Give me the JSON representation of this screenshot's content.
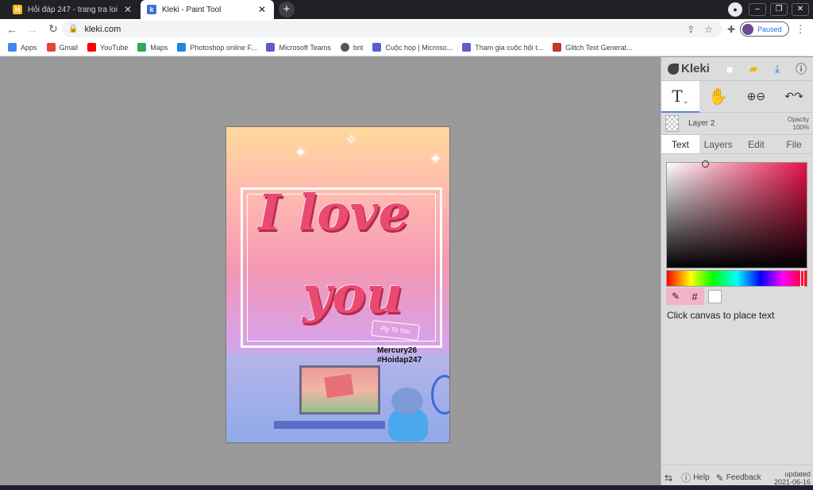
{
  "tabs": [
    {
      "title": "Hỏi đáp 247 - trang tra loi",
      "close": "✕"
    },
    {
      "title": "Kleki - Paint Tool",
      "close": "✕"
    }
  ],
  "new_tab": "+",
  "window_controls": {
    "minimize": "–",
    "maximize": "❐",
    "close": "✕"
  },
  "address": {
    "url": "kleki.com",
    "lock": "🔒"
  },
  "profile": {
    "label": "Paused"
  },
  "bookmarks": [
    {
      "label": "Apps",
      "color": "#4285f4"
    },
    {
      "label": "Gmail",
      "color": "#ea4335"
    },
    {
      "label": "YouTube",
      "color": "#ff0000"
    },
    {
      "label": "Maps",
      "color": "#34a853"
    },
    {
      "label": "Photoshop online F...",
      "color": "#1e88e5"
    },
    {
      "label": "Microsoft Teams",
      "color": "#5b5fc7"
    },
    {
      "label": "bnt",
      "color": "#555555"
    },
    {
      "label": "Cuộc họp | Microso...",
      "color": "#5b5fc7"
    },
    {
      "label": "Tham gia cuộc hội t...",
      "color": "#5b5fc7"
    },
    {
      "label": "Glitch Text Generat...",
      "color": "#c0392b"
    }
  ],
  "canvas": {
    "line1": "I love",
    "line2": "you",
    "ribbon": "Fly To You",
    "signature1": "Mercury26",
    "signature2": "#Hoidap247"
  },
  "kleki": {
    "logo": "Kleki",
    "layer_name": "Layer 2",
    "opacity_label": "Opacity",
    "opacity_value": "100%",
    "tabs": [
      "Text",
      "Layers",
      "Edit",
      "File"
    ],
    "hint": "Click canvas to place text",
    "footer": {
      "help": "Help",
      "feedback": "Feedback",
      "updated1": "updated",
      "updated2": "2021-06-16"
    },
    "hash": "#",
    "accent": "#5a86d6"
  }
}
